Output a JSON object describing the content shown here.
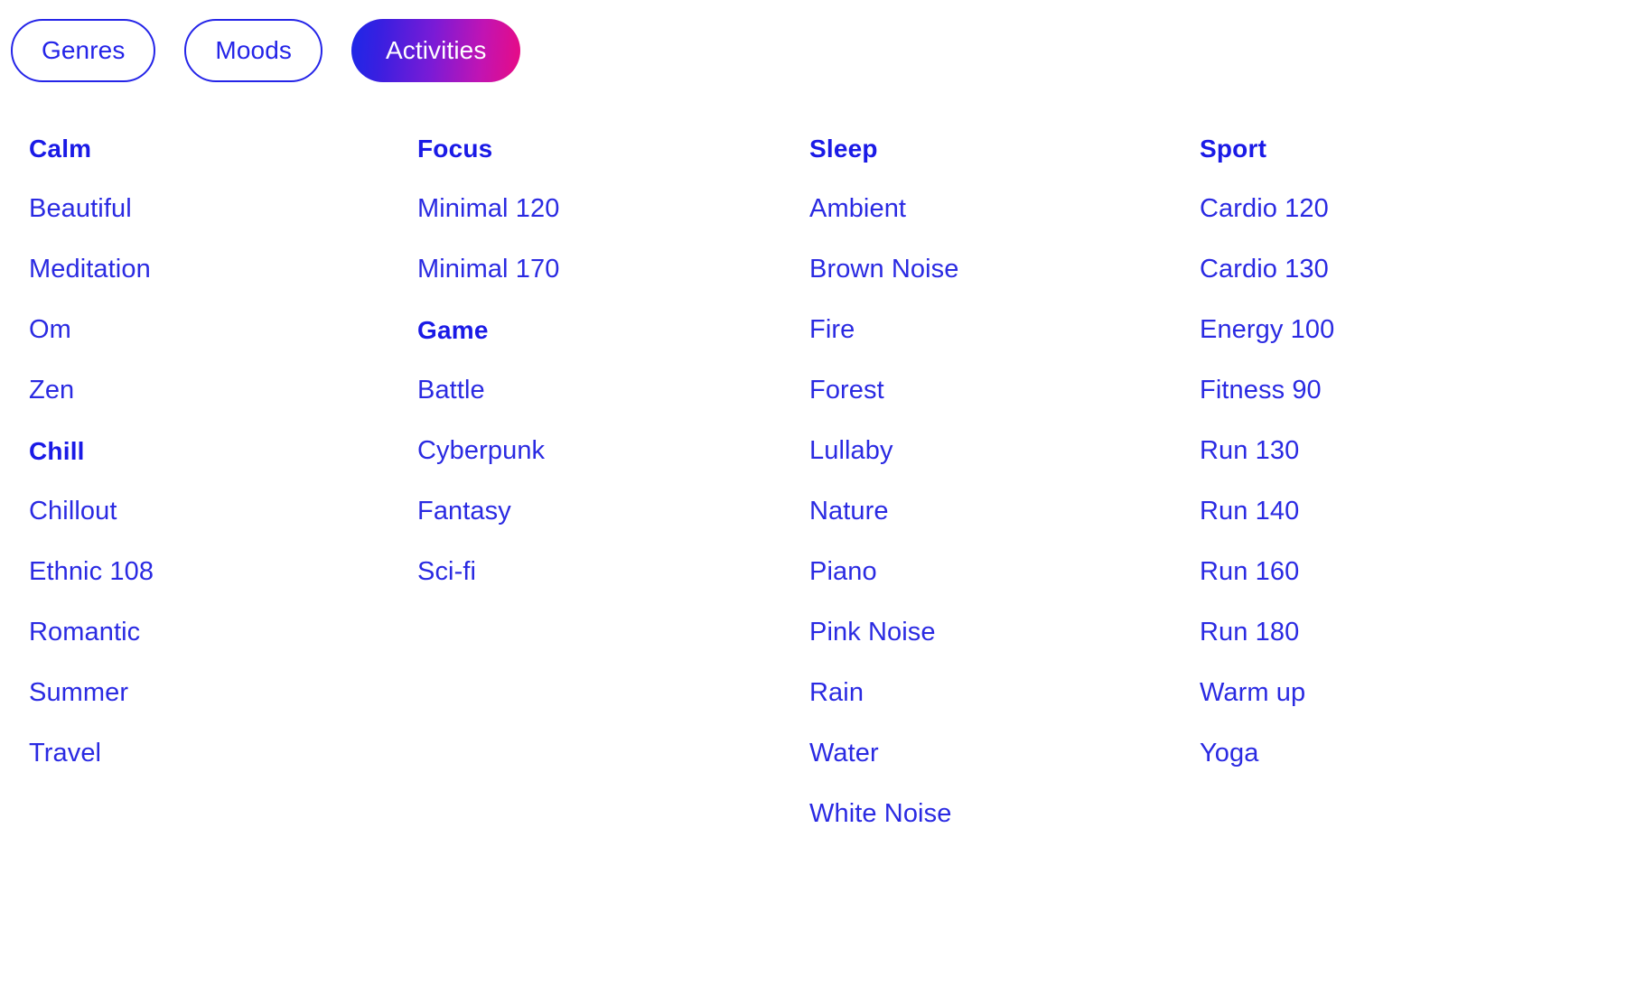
{
  "theme": {
    "background": "#ffffff",
    "link_blue": "#2a2ae2",
    "heading_blue": "#1a1ae6",
    "pill_border_blue": "#2424e8",
    "pill_active_gradient_from": "#1c28e8",
    "pill_active_gradient_to": "#e80b84",
    "pill_active_text": "#ffffff"
  },
  "filter_bar": {
    "tabs": [
      {
        "label": "Genres",
        "active": false
      },
      {
        "label": "Moods",
        "active": false
      },
      {
        "label": "Activities",
        "active": true
      }
    ]
  },
  "columns": [
    {
      "name": "column-1",
      "rows": [
        {
          "type": "heading",
          "label": "Calm"
        },
        {
          "type": "item",
          "label": "Beautiful"
        },
        {
          "type": "item",
          "label": "Meditation"
        },
        {
          "type": "item",
          "label": "Om"
        },
        {
          "type": "item",
          "label": "Zen"
        },
        {
          "type": "heading",
          "label": "Chill"
        },
        {
          "type": "item",
          "label": "Chillout"
        },
        {
          "type": "item",
          "label": "Ethnic 108"
        },
        {
          "type": "item",
          "label": "Romantic"
        },
        {
          "type": "item",
          "label": "Summer"
        },
        {
          "type": "item",
          "label": "Travel"
        }
      ]
    },
    {
      "name": "column-2",
      "rows": [
        {
          "type": "heading",
          "label": "Focus"
        },
        {
          "type": "item",
          "label": "Minimal 120"
        },
        {
          "type": "item",
          "label": "Minimal 170"
        },
        {
          "type": "heading",
          "label": "Game"
        },
        {
          "type": "item",
          "label": "Battle"
        },
        {
          "type": "item",
          "label": "Cyberpunk"
        },
        {
          "type": "item",
          "label": "Fantasy"
        },
        {
          "type": "item",
          "label": "Sci-fi"
        }
      ]
    },
    {
      "name": "column-3",
      "rows": [
        {
          "type": "heading",
          "label": "Sleep"
        },
        {
          "type": "item",
          "label": "Ambient"
        },
        {
          "type": "item",
          "label": "Brown Noise"
        },
        {
          "type": "item",
          "label": "Fire"
        },
        {
          "type": "item",
          "label": "Forest"
        },
        {
          "type": "item",
          "label": "Lullaby"
        },
        {
          "type": "item",
          "label": "Nature"
        },
        {
          "type": "item",
          "label": "Piano"
        },
        {
          "type": "item",
          "label": "Pink Noise"
        },
        {
          "type": "item",
          "label": "Rain"
        },
        {
          "type": "item",
          "label": "Water"
        },
        {
          "type": "item",
          "label": "White Noise"
        }
      ]
    },
    {
      "name": "column-4",
      "rows": [
        {
          "type": "heading",
          "label": "Sport"
        },
        {
          "type": "item",
          "label": "Cardio 120"
        },
        {
          "type": "item",
          "label": "Cardio 130"
        },
        {
          "type": "item",
          "label": "Energy 100"
        },
        {
          "type": "item",
          "label": "Fitness 90"
        },
        {
          "type": "item",
          "label": "Run 130"
        },
        {
          "type": "item",
          "label": "Run 140"
        },
        {
          "type": "item",
          "label": "Run 160"
        },
        {
          "type": "item",
          "label": "Run 180"
        },
        {
          "type": "item",
          "label": "Warm up"
        },
        {
          "type": "item",
          "label": "Yoga"
        }
      ]
    }
  ]
}
